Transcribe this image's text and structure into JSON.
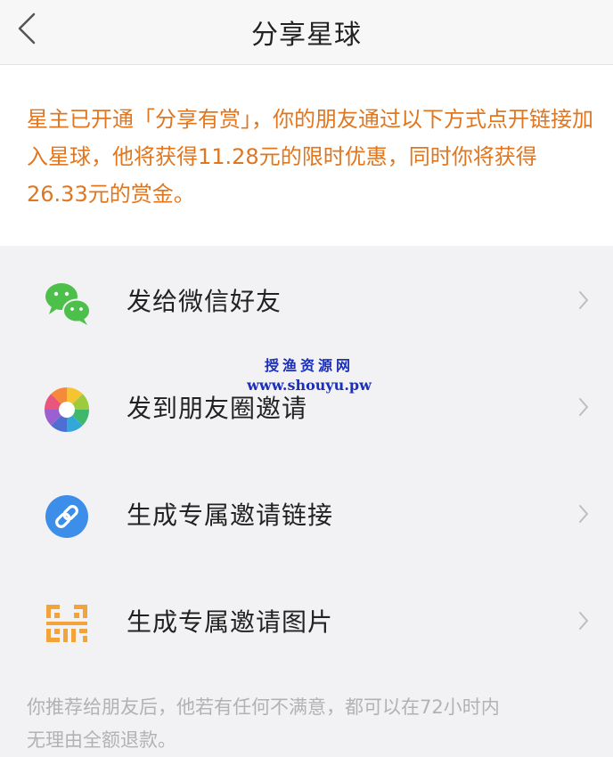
{
  "header": {
    "title": "分享星球",
    "back_icon": "chevron-left-icon"
  },
  "notice": {
    "text": "星主已开通「分享有赏」，你的朋友通过以下方式点开链接加入星球，他将获得11.28元的限时优惠，同时你将获得26.33元的赏金。",
    "color": "#e0761f"
  },
  "menu": {
    "items": [
      {
        "label": "发给微信好友",
        "icon": "wechat-icon"
      },
      {
        "label": "发到朋友圈邀请",
        "icon": "moments-icon"
      },
      {
        "label": "生成专属邀请链接",
        "icon": "link-icon"
      },
      {
        "label": "生成专属邀请图片",
        "icon": "qr-code-icon"
      }
    ]
  },
  "watermark": {
    "line1": "授渔资源网",
    "line2": "www.shouyu.pw"
  },
  "footnote": {
    "text": "你推荐给朋友后，他若有任何不满意，都可以在72小时内无理由全额退款。"
  }
}
